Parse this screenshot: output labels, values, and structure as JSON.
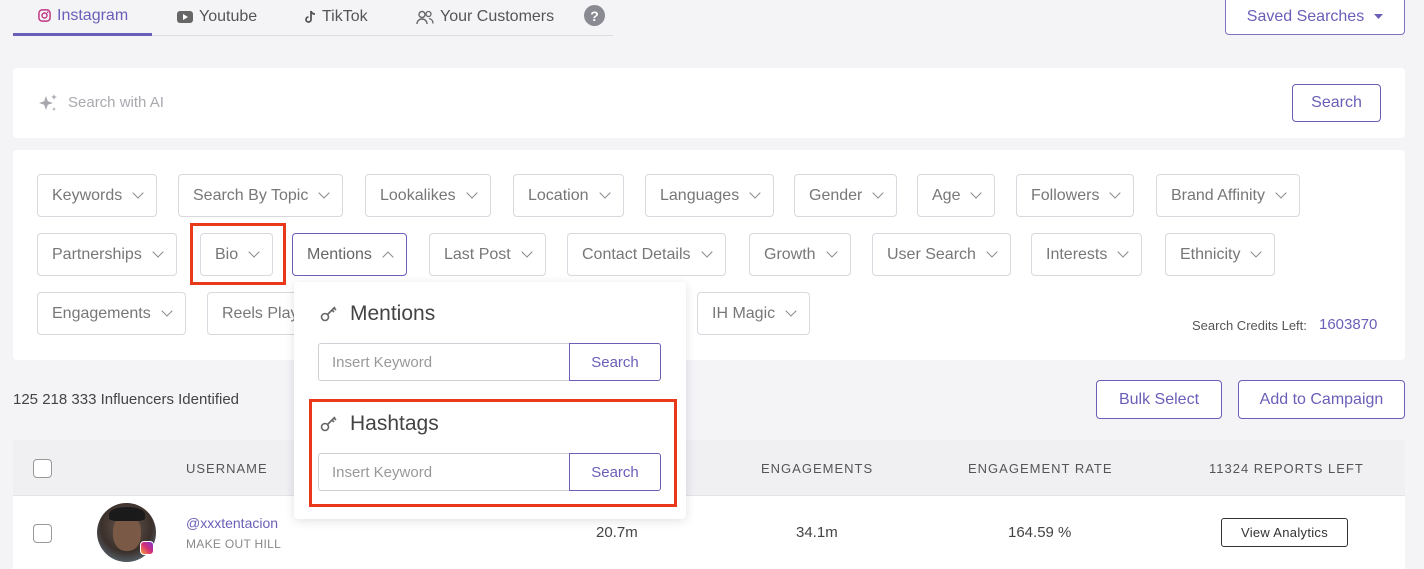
{
  "platform_tabs": [
    {
      "label": "Instagram",
      "icon": "instagram-icon",
      "active": true
    },
    {
      "label": "Youtube",
      "icon": "youtube-icon",
      "active": false
    },
    {
      "label": "TikTok",
      "icon": "tiktok-icon",
      "active": false
    },
    {
      "label": "Your Customers",
      "icon": "users-icon",
      "active": false
    }
  ],
  "help_glyph": "?",
  "saved_searches": {
    "label": "Saved Searches",
    "icon": "caret-down-icon"
  },
  "ai_search": {
    "placeholder": "Search with AI",
    "button": "Search",
    "icon": "sparkle-icon"
  },
  "filters": {
    "row1": [
      "Keywords",
      "Search By Topic",
      "Lookalikes",
      "Location",
      "Languages",
      "Gender",
      "Age",
      "Followers",
      "Brand Affinity"
    ],
    "row2": [
      "Partnerships",
      "Bio",
      "Mentions",
      "Last Post",
      "Contact Details",
      "Growth",
      "User Search",
      "Interests",
      "Ethnicity"
    ],
    "row3": [
      "Engagements",
      "Reels Plays",
      "IH Magic"
    ],
    "open_filter": "Mentions",
    "credits_label": "Search Credits Left:",
    "credits_value": "1603870"
  },
  "mentions_popup": {
    "mentions_title": "Mentions",
    "mentions_placeholder": "Insert Keyword",
    "mentions_button": "Search",
    "hashtags_title": "Hashtags",
    "hashtags_placeholder": "Insert Keyword",
    "hashtags_button": "Search",
    "icon": "key-icon"
  },
  "results": {
    "count_text": "125 218 333 Influencers Identified",
    "bulk_select": "Bulk Select",
    "add_to_campaign": "Add to Campaign"
  },
  "table": {
    "headers": {
      "username": "USERNAME",
      "engagements": "ENGAGEMENTS",
      "engagement_rate": "ENGAGEMENT RATE",
      "reports_left": "11324 REPORTS LEFT"
    },
    "rows": [
      {
        "username": "@xxxtentacion",
        "name": "MAKE OUT HILL",
        "followers": "20.7m",
        "engagements": "34.1m",
        "engagement_rate": "164.59 %",
        "action": "View Analytics"
      }
    ]
  },
  "colors": {
    "accent": "#6a5fb8",
    "highlight": "#e8391b"
  }
}
